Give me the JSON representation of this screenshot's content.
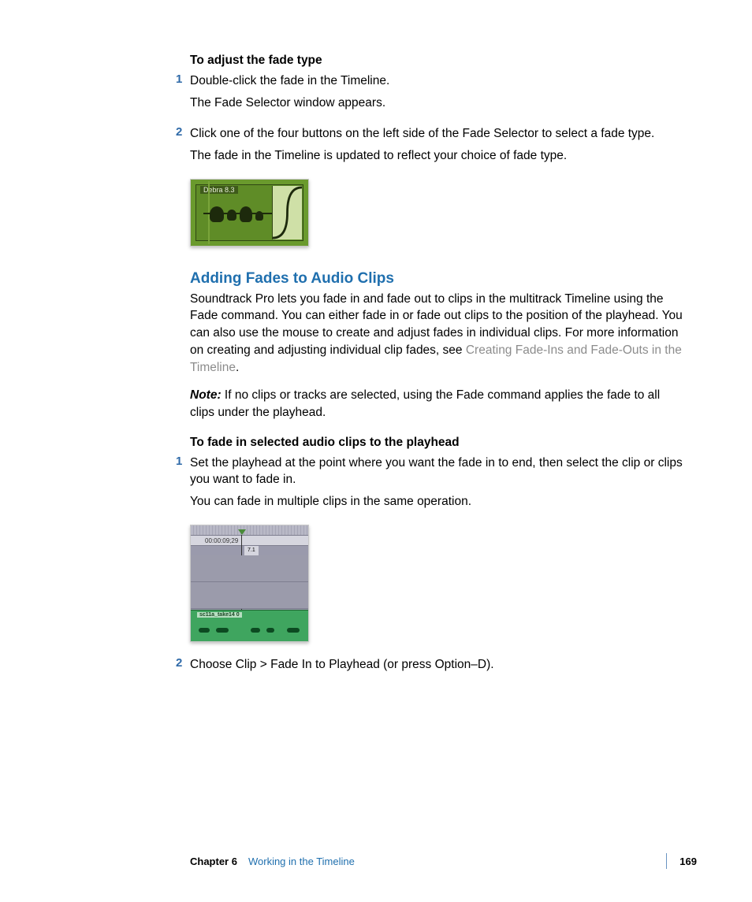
{
  "sec1": {
    "heading": "To adjust the fade type",
    "steps": [
      {
        "num": "1",
        "text": "Double-click the fade in the Timeline.",
        "sub": "The Fade Selector window appears."
      },
      {
        "num": "2",
        "text": "Click one of the four buttons on the left side of the Fade Selector to select a fade type.",
        "sub": "The fade in the Timeline is updated to reflect your choice of fade type."
      }
    ]
  },
  "fig1": {
    "clip_label": "Debra 8.3"
  },
  "sec2": {
    "heading": "Adding Fades to Audio Clips",
    "p1a": "Soundtrack Pro lets you fade in and fade out to clips in the multitrack Timeline using the Fade command. You can either fade in or fade out clips to the position of the playhead. You can also use the mouse to create and adjust fades in individual clips. For more information on creating and adjusting individual clip fades, see ",
    "link": "Creating Fade-Ins and Fade-Outs in the Timeline",
    "p1b": ".",
    "note_label": "Note:",
    "note_text": "  If no clips or tracks are selected, using the Fade command applies the fade to all clips under the playhead."
  },
  "sec3": {
    "heading": "To fade in selected audio clips to the playhead",
    "steps": [
      {
        "num": "1",
        "text": "Set the playhead at the point where you want the fade in to end, then select the clip or clips you want to fade in.",
        "sub": "You can fade in multiple clips in the same operation."
      },
      {
        "num": "2",
        "text": "Choose Clip > Fade In to Playhead (or press Option–D)."
      }
    ]
  },
  "fig2": {
    "timecode": "00:00:09;29",
    "tc2": "7.1",
    "clip_label": "sc11a_take14 0"
  },
  "footer": {
    "chapter": "Chapter 6",
    "title": "Working in the Timeline",
    "page": "169"
  }
}
